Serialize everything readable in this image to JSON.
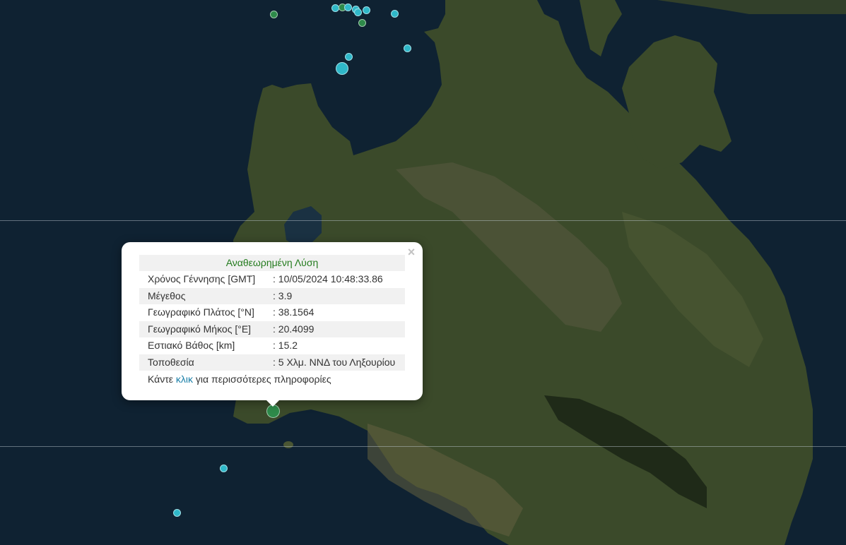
{
  "colors": {
    "water": "#0f2232",
    "land_dark": "#2c3a22",
    "land_mid": "#4a5633",
    "land_light": "#6d6c4d",
    "marker_green": "#2e8a4a",
    "marker_cyan": "#2fb8c9",
    "popup_title": "#237b1d",
    "link": "#1a7fa8"
  },
  "map": {
    "icon": "satellite-map",
    "markers": [
      {
        "color": "green",
        "size": "small"
      },
      {
        "color": "cyan",
        "size": "small"
      },
      {
        "color": "green",
        "size": "small"
      },
      {
        "color": "cyan",
        "size": "small"
      },
      {
        "color": "cyan",
        "size": "small"
      },
      {
        "color": "cyan",
        "size": "small"
      },
      {
        "color": "cyan",
        "size": "small"
      },
      {
        "color": "green",
        "size": "small"
      },
      {
        "color": "cyan",
        "size": "small"
      },
      {
        "color": "cyan",
        "size": "small"
      },
      {
        "color": "cyan",
        "size": "small"
      },
      {
        "color": "cyan",
        "size": "large"
      },
      {
        "color": "green",
        "size": "selected"
      },
      {
        "color": "cyan",
        "size": "small"
      },
      {
        "color": "cyan",
        "size": "small"
      }
    ]
  },
  "popup": {
    "close_icon": "×",
    "title": "Αναθεωρημένη Λύση",
    "rows": [
      {
        "label": "Χρόνος Γέννησης [GMT]",
        "value": ": 10/05/2024 10:48:33.86"
      },
      {
        "label": "Μέγεθος",
        "value": ": 3.9"
      },
      {
        "label": "Γεωγραφικό Πλάτος [°N]",
        "value": ": 38.1564"
      },
      {
        "label": "Γεωγραφικό Μήκος [°E]",
        "value": ": 20.4099"
      },
      {
        "label": "Εστιακό Βάθος [km]",
        "value": ": 15.2"
      },
      {
        "label": "Τοποθεσία",
        "value": ": 5 Χλμ. ΝΝΔ του Ληξουρίου"
      }
    ],
    "more_prefix": "Κάντε ",
    "more_link": "κλικ",
    "more_suffix": " για περισσότερες πληροφορίες"
  }
}
